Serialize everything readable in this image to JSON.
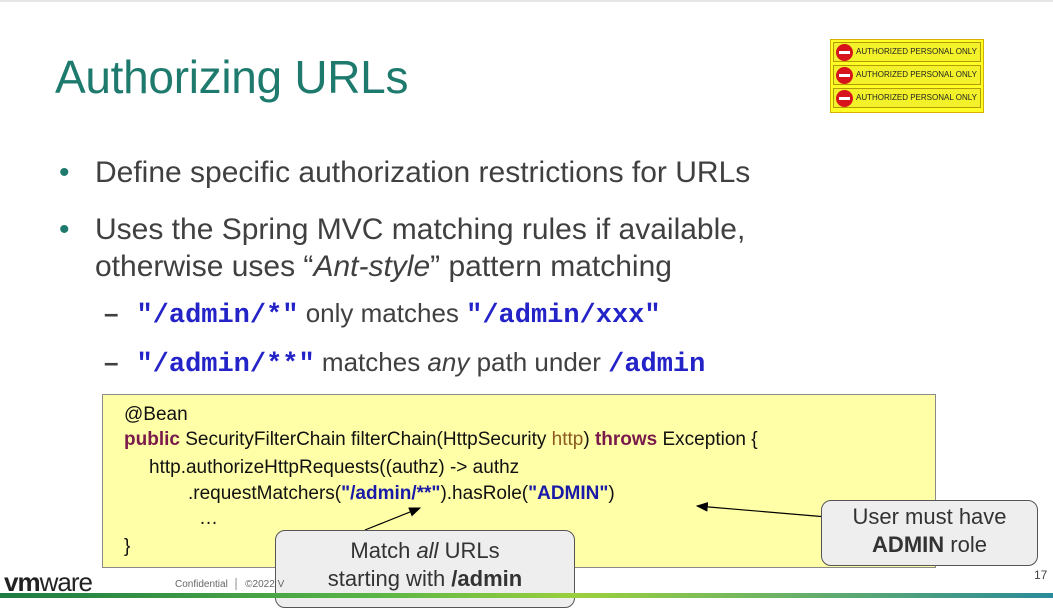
{
  "title": "Authorizing URLs",
  "warning_sign": [
    "AUTHORIZED PERSONAL ONLY",
    "AUTHORIZED PERSONAL ONLY",
    "AUTHORIZED PERSONAL ONLY"
  ],
  "bullets": {
    "b1": "Define specific authorization restrictions for URLs",
    "b2_line1": "Uses the Spring MVC matching rules if available,",
    "b2_line2_pre": "otherwise uses “",
    "b2_line2_em": "Ant-style",
    "b2_line2_post": "” pattern matching"
  },
  "subs": {
    "s1_code1": "\"/admin/*\"",
    "s1_text": " only matches ",
    "s1_code2": "\"/admin/xxx\"",
    "s2_code1": "\"/admin/**\"",
    "s2_text1": " matches ",
    "s2_em": "any",
    "s2_text2": " path under ",
    "s2_code2": "/admin"
  },
  "code": {
    "l1": "@Bean",
    "l2_kw": "public",
    "l2_a": " SecurityFilterChain filterChain(HttpSecurity ",
    "l2_param": "http",
    "l2_b": ") ",
    "l2_kw2": "throws",
    "l2_c": " Exception {",
    "l3": "http.authorizeHttpRequests((authz) -> authz",
    "l4_a": ".requestMatchers(",
    "l4_str": "\"/admin/**\"",
    "l4_b": ").hasRole(",
    "l4_str2": "\"ADMIN\"",
    "l4_c": ")",
    "l5": "…",
    "l6": "}"
  },
  "callouts": {
    "c1_line1": "User must have",
    "c1_bold": "ADMIN",
    "c1_post": " role",
    "c2_pre": "Match ",
    "c2_em": "all",
    "c2_post": " URLs",
    "c2_line2_pre": "starting with ",
    "c2_bold": "/admin"
  },
  "footer": {
    "logo_vm": "vm",
    "logo_ware": "ware",
    "text": "Confidential  │  ©2022 V",
    "page": "17"
  },
  "colors": {
    "title": "#1f7a6e",
    "codebox_bg": "#ffffa8",
    "code_blue": "#2323c8"
  }
}
